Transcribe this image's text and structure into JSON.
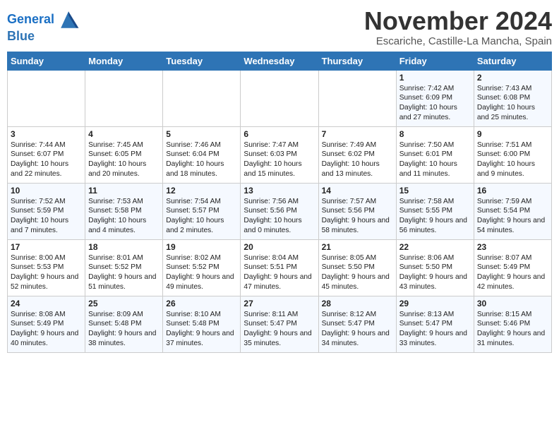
{
  "header": {
    "logo_line1": "General",
    "logo_line2": "Blue",
    "month": "November 2024",
    "location": "Escariche, Castille-La Mancha, Spain"
  },
  "days_of_week": [
    "Sunday",
    "Monday",
    "Tuesday",
    "Wednesday",
    "Thursday",
    "Friday",
    "Saturday"
  ],
  "weeks": [
    [
      {
        "day": "",
        "text": ""
      },
      {
        "day": "",
        "text": ""
      },
      {
        "day": "",
        "text": ""
      },
      {
        "day": "",
        "text": ""
      },
      {
        "day": "",
        "text": ""
      },
      {
        "day": "1",
        "text": "Sunrise: 7:42 AM\nSunset: 6:09 PM\nDaylight: 10 hours and 27 minutes."
      },
      {
        "day": "2",
        "text": "Sunrise: 7:43 AM\nSunset: 6:08 PM\nDaylight: 10 hours and 25 minutes."
      }
    ],
    [
      {
        "day": "3",
        "text": "Sunrise: 7:44 AM\nSunset: 6:07 PM\nDaylight: 10 hours and 22 minutes."
      },
      {
        "day": "4",
        "text": "Sunrise: 7:45 AM\nSunset: 6:05 PM\nDaylight: 10 hours and 20 minutes."
      },
      {
        "day": "5",
        "text": "Sunrise: 7:46 AM\nSunset: 6:04 PM\nDaylight: 10 hours and 18 minutes."
      },
      {
        "day": "6",
        "text": "Sunrise: 7:47 AM\nSunset: 6:03 PM\nDaylight: 10 hours and 15 minutes."
      },
      {
        "day": "7",
        "text": "Sunrise: 7:49 AM\nSunset: 6:02 PM\nDaylight: 10 hours and 13 minutes."
      },
      {
        "day": "8",
        "text": "Sunrise: 7:50 AM\nSunset: 6:01 PM\nDaylight: 10 hours and 11 minutes."
      },
      {
        "day": "9",
        "text": "Sunrise: 7:51 AM\nSunset: 6:00 PM\nDaylight: 10 hours and 9 minutes."
      }
    ],
    [
      {
        "day": "10",
        "text": "Sunrise: 7:52 AM\nSunset: 5:59 PM\nDaylight: 10 hours and 7 minutes."
      },
      {
        "day": "11",
        "text": "Sunrise: 7:53 AM\nSunset: 5:58 PM\nDaylight: 10 hours and 4 minutes."
      },
      {
        "day": "12",
        "text": "Sunrise: 7:54 AM\nSunset: 5:57 PM\nDaylight: 10 hours and 2 minutes."
      },
      {
        "day": "13",
        "text": "Sunrise: 7:56 AM\nSunset: 5:56 PM\nDaylight: 10 hours and 0 minutes."
      },
      {
        "day": "14",
        "text": "Sunrise: 7:57 AM\nSunset: 5:56 PM\nDaylight: 9 hours and 58 minutes."
      },
      {
        "day": "15",
        "text": "Sunrise: 7:58 AM\nSunset: 5:55 PM\nDaylight: 9 hours and 56 minutes."
      },
      {
        "day": "16",
        "text": "Sunrise: 7:59 AM\nSunset: 5:54 PM\nDaylight: 9 hours and 54 minutes."
      }
    ],
    [
      {
        "day": "17",
        "text": "Sunrise: 8:00 AM\nSunset: 5:53 PM\nDaylight: 9 hours and 52 minutes."
      },
      {
        "day": "18",
        "text": "Sunrise: 8:01 AM\nSunset: 5:52 PM\nDaylight: 9 hours and 51 minutes."
      },
      {
        "day": "19",
        "text": "Sunrise: 8:02 AM\nSunset: 5:52 PM\nDaylight: 9 hours and 49 minutes."
      },
      {
        "day": "20",
        "text": "Sunrise: 8:04 AM\nSunset: 5:51 PM\nDaylight: 9 hours and 47 minutes."
      },
      {
        "day": "21",
        "text": "Sunrise: 8:05 AM\nSunset: 5:50 PM\nDaylight: 9 hours and 45 minutes."
      },
      {
        "day": "22",
        "text": "Sunrise: 8:06 AM\nSunset: 5:50 PM\nDaylight: 9 hours and 43 minutes."
      },
      {
        "day": "23",
        "text": "Sunrise: 8:07 AM\nSunset: 5:49 PM\nDaylight: 9 hours and 42 minutes."
      }
    ],
    [
      {
        "day": "24",
        "text": "Sunrise: 8:08 AM\nSunset: 5:49 PM\nDaylight: 9 hours and 40 minutes."
      },
      {
        "day": "25",
        "text": "Sunrise: 8:09 AM\nSunset: 5:48 PM\nDaylight: 9 hours and 38 minutes."
      },
      {
        "day": "26",
        "text": "Sunrise: 8:10 AM\nSunset: 5:48 PM\nDaylight: 9 hours and 37 minutes."
      },
      {
        "day": "27",
        "text": "Sunrise: 8:11 AM\nSunset: 5:47 PM\nDaylight: 9 hours and 35 minutes."
      },
      {
        "day": "28",
        "text": "Sunrise: 8:12 AM\nSunset: 5:47 PM\nDaylight: 9 hours and 34 minutes."
      },
      {
        "day": "29",
        "text": "Sunrise: 8:13 AM\nSunset: 5:47 PM\nDaylight: 9 hours and 33 minutes."
      },
      {
        "day": "30",
        "text": "Sunrise: 8:15 AM\nSunset: 5:46 PM\nDaylight: 9 hours and 31 minutes."
      }
    ]
  ]
}
